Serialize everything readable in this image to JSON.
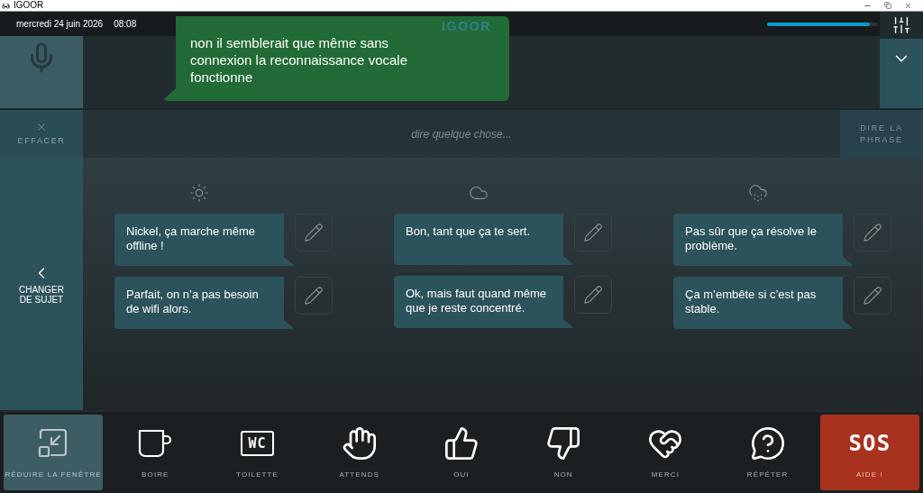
{
  "window": {
    "title": "IGOOR"
  },
  "header": {
    "date": "mercredi 24 juin 2026",
    "time": "08:08",
    "logo": "IGOOR",
    "volume": {
      "level": 0.93
    }
  },
  "spoken_bubble": {
    "text": "non il semblerait que même sans connexion la reconnaissance vocale fonctionne"
  },
  "input_row": {
    "clear_button": {
      "label": "EFFACER",
      "disabled": true
    },
    "input": {
      "placeholder": "dire quelque chose..."
    },
    "speak_button": {
      "label": "DIRE LA PHRASE",
      "disabled": true
    }
  },
  "topic_button": {
    "label": "CHANGER DE SUJET"
  },
  "columns": [
    {
      "kind": "sun",
      "phrases": [
        "Nickel, ça marche même offline !",
        "Parfait, on n’a pas besoin de wifi alors."
      ]
    },
    {
      "kind": "cloud",
      "phrases": [
        "Bon, tant que ça te sert.",
        "Ok, mais faut quand même que je reste concentré."
      ]
    },
    {
      "kind": "rain",
      "phrases": [
        "Pas sûr que ça résolve le problème.",
        "Ça m’embête si c’est pas stable."
      ]
    }
  ],
  "bottom_bar": [
    {
      "kind": "shrink",
      "label": "RÉDUIRE LA FENÊTRE",
      "selected": true
    },
    {
      "kind": "cup",
      "label": "BOIRE",
      "selected": false
    },
    {
      "kind": "wc",
      "symbol": "WC",
      "label": "TOILETTE",
      "selected": false
    },
    {
      "kind": "hand",
      "label": "ATTENDS",
      "selected": false
    },
    {
      "kind": "thumbs-up",
      "label": "OUI",
      "selected": false
    },
    {
      "kind": "thumbs-down",
      "label": "NON",
      "selected": false
    },
    {
      "kind": "heart",
      "label": "MERCI",
      "selected": false
    },
    {
      "kind": "question",
      "label": "RÉPÉTER",
      "selected": false
    },
    {
      "kind": "sos",
      "symbol": "SOS",
      "label": "AIDE !",
      "selected": false
    }
  ]
}
